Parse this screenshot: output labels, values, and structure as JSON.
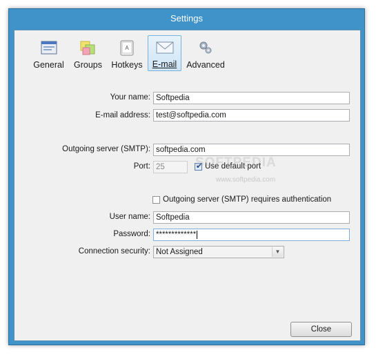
{
  "window": {
    "title": "Settings"
  },
  "tabs": [
    {
      "label": "General",
      "icon": "general-icon",
      "active": false
    },
    {
      "label": "Groups",
      "icon": "groups-icon",
      "active": false
    },
    {
      "label": "Hotkeys",
      "icon": "hotkeys-icon",
      "active": false
    },
    {
      "label": "E-mail",
      "icon": "email-icon",
      "active": true
    },
    {
      "label": "Advanced",
      "icon": "advanced-icon",
      "active": false
    }
  ],
  "form": {
    "your_name_label": "Your name:",
    "your_name_value": "Softpedia",
    "email_label": "E-mail address:",
    "email_value": "test@softpedia.com",
    "smtp_label": "Outgoing server (SMTP):",
    "smtp_value": "softpedia.com",
    "port_label": "Port:",
    "port_value": "25",
    "default_port_label": "Use default port",
    "default_port_checked": true,
    "auth_label": "Outgoing server (SMTP) requires authentication",
    "auth_checked": false,
    "username_label": "User name:",
    "username_value": "Softpedia",
    "password_label": "Password:",
    "password_value": "*************",
    "security_label": "Connection security:",
    "security_value": "Not Assigned"
  },
  "buttons": {
    "close": "Close"
  },
  "watermark": {
    "text": "SOFTPEDIA",
    "url": "www.softpedia.com"
  },
  "colors": {
    "titlebar": "#3f93c8",
    "active_tab": "#cfe5f7",
    "background": "#f0f0f0"
  }
}
